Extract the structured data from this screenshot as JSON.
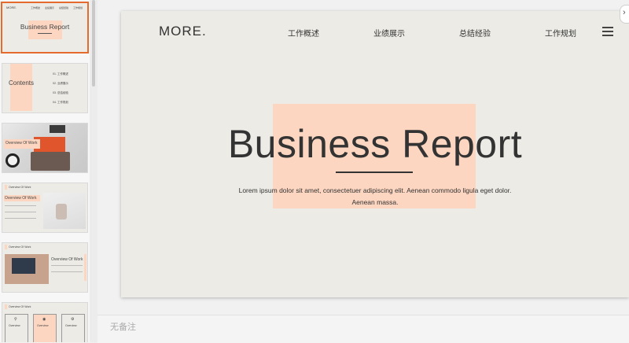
{
  "thumbnails": {
    "slide1": {
      "logo": "MORE.",
      "nav": [
        "工作概述",
        "业绩展示",
        "总结经验",
        "工作规划"
      ],
      "title": "Business Report"
    },
    "slide2": {
      "title": "Contents",
      "items": [
        "01. 工作概述",
        "02. 业绩展示",
        "03. 总结经验",
        "04. 工作规划"
      ]
    },
    "slide3": {
      "title": "Overview Of Work"
    },
    "slide4": {
      "header": "Overview Of Work",
      "title": "Overview Of Work"
    },
    "slide5": {
      "header": "Overview Of Work",
      "title": "Overview Of Work"
    },
    "slide6": {
      "header": "Overview Of Work",
      "cards": [
        "Overview",
        "Overview",
        "Overview"
      ]
    }
  },
  "slide": {
    "logo": "MORE.",
    "nav": [
      "工作概述",
      "业绩展示",
      "总结经验",
      "工作规划"
    ],
    "title": "Business Report",
    "body_line1": "Lorem ipsum dolor sit amet, consectetuer adipiscing elit. Aenean commodo ligula eget dolor.",
    "body_line2": "Aenean massa."
  },
  "notes": {
    "placeholder": "无备注"
  },
  "colors": {
    "accent_peach": "#fdd6c1",
    "selection_orange": "#e56a2e",
    "slide_bg": "#ecebe6",
    "text": "#333333"
  }
}
